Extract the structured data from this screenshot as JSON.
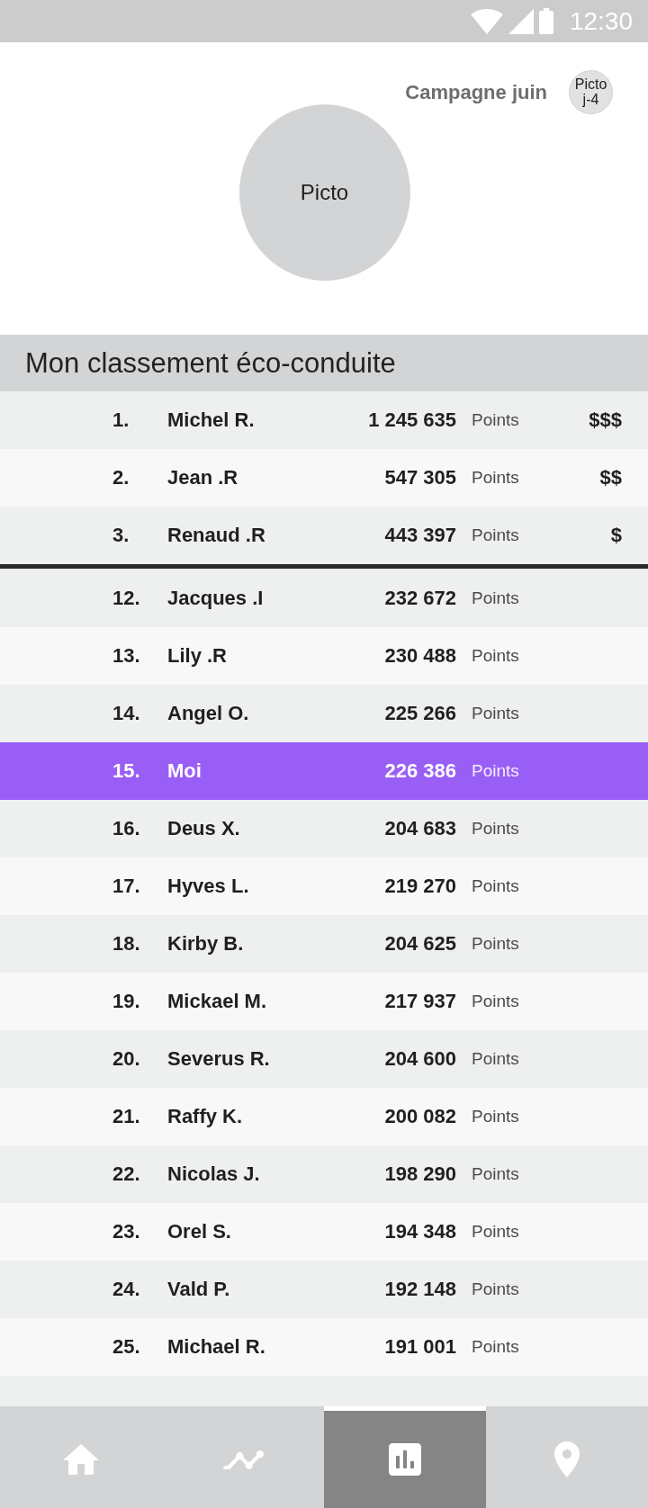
{
  "status_bar": {
    "time": "12:30"
  },
  "header": {
    "campaign": "Campagne juin",
    "badge": "Picto j-4",
    "picto": "Picto"
  },
  "ranking": {
    "title": "Mon classement éco-conduite",
    "podium": [
      {
        "rank": "1.",
        "name": "Michel R.",
        "points": "1 245 635",
        "unit": "Points",
        "reward": "$$$",
        "selected": false
      },
      {
        "rank": "2.",
        "name": "Jean .R",
        "points": "547 305",
        "unit": "Points",
        "reward": "$$",
        "selected": false
      },
      {
        "rank": "3.",
        "name": "Renaud .R",
        "points": "443 397",
        "unit": "Points",
        "reward": "$",
        "selected": false
      }
    ],
    "others": [
      {
        "rank": "12.",
        "name": "Jacques .I",
        "points": "232 672",
        "unit": "Points",
        "selected": false
      },
      {
        "rank": "13.",
        "name": "Lily .R",
        "points": "230 488",
        "unit": "Points",
        "selected": false
      },
      {
        "rank": "14.",
        "name": "Angel O.",
        "points": "225 266",
        "unit": "Points",
        "selected": false
      },
      {
        "rank": "15.",
        "name": "Moi",
        "points": "226 386",
        "unit": "Points",
        "selected": true
      },
      {
        "rank": "16.",
        "name": "Deus X.",
        "points": "204 683",
        "unit": "Points",
        "selected": false
      },
      {
        "rank": "17.",
        "name": "Hyves L.",
        "points": "219 270",
        "unit": "Points",
        "selected": false
      },
      {
        "rank": "18.",
        "name": "Kirby B.",
        "points": "204 625",
        "unit": "Points",
        "selected": false
      },
      {
        "rank": "19.",
        "name": "Mickael M.",
        "points": "217 937",
        "unit": "Points",
        "selected": false
      },
      {
        "rank": "20.",
        "name": "Severus R.",
        "points": "204 600",
        "unit": "Points",
        "selected": false
      },
      {
        "rank": "21.",
        "name": "Raffy K.",
        "points": "200 082",
        "unit": "Points",
        "selected": false
      },
      {
        "rank": "22.",
        "name": "Nicolas J.",
        "points": "198 290",
        "unit": "Points",
        "selected": false
      },
      {
        "rank": "23.",
        "name": "Orel S.",
        "points": "194 348",
        "unit": "Points",
        "selected": false
      },
      {
        "rank": "24.",
        "name": "Vald P.",
        "points": "192 148",
        "unit": "Points",
        "selected": false
      },
      {
        "rank": "25.",
        "name": "Michael R.",
        "points": "191 001",
        "unit": "Points",
        "selected": false
      }
    ]
  },
  "nav": [
    {
      "kind": "home",
      "selected": false
    },
    {
      "kind": "trend",
      "selected": false
    },
    {
      "kind": "stats",
      "selected": true
    },
    {
      "kind": "location",
      "selected": false
    }
  ]
}
